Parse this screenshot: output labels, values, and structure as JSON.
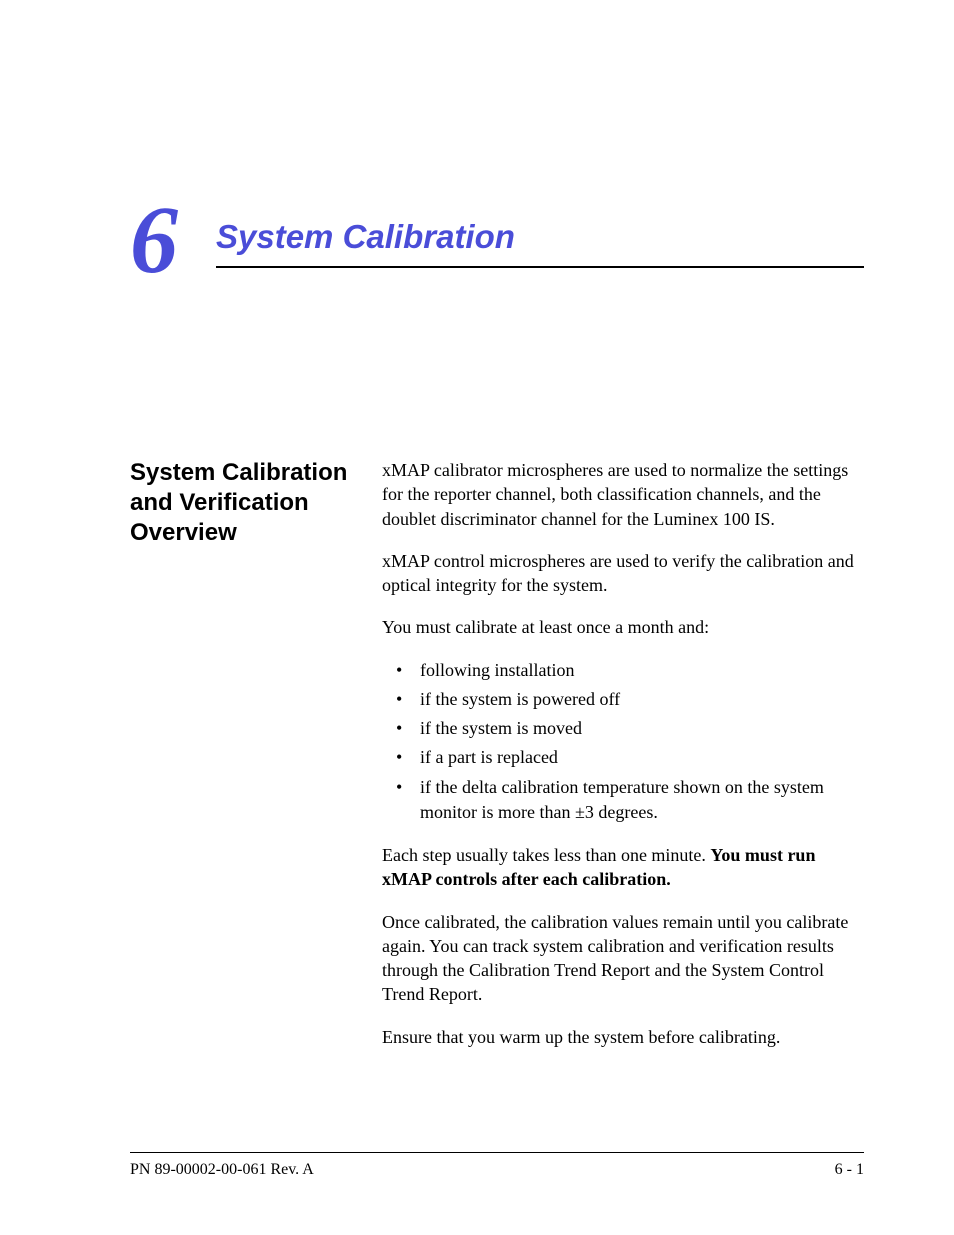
{
  "chapter": {
    "number": "6",
    "title": "System Calibration"
  },
  "section_heading": "System Calibration and Verification Overview",
  "body": {
    "para1": "xMAP calibrator microspheres are used to normalize the settings for the reporter channel, both classification channels, and the doublet discriminator channel for the Luminex 100 IS.",
    "para2": "xMAP control microspheres are used to verify the calibration and optical integrity for the system.",
    "para3": "You must calibrate at least once a month and:",
    "bullets": [
      "following installation",
      "if the system is powered off",
      "if the system is moved",
      "if a part is replaced",
      "if the delta calibration temperature shown on the system monitor is more than ±3 degrees."
    ],
    "para4_text": "Each step usually takes less than one minute. ",
    "para4_bold": "You must run xMAP controls after each calibration.",
    "para5": "Once calibrated, the calibration values remain until you calibrate again. You can track system calibration and verification results through the Calibration Trend Report and the System Control Trend Report.",
    "para6": "Ensure that you warm up the system before calibrating."
  },
  "footer": {
    "left": "PN 89-00002-00-061 Rev. A",
    "right": "6 - 1"
  }
}
